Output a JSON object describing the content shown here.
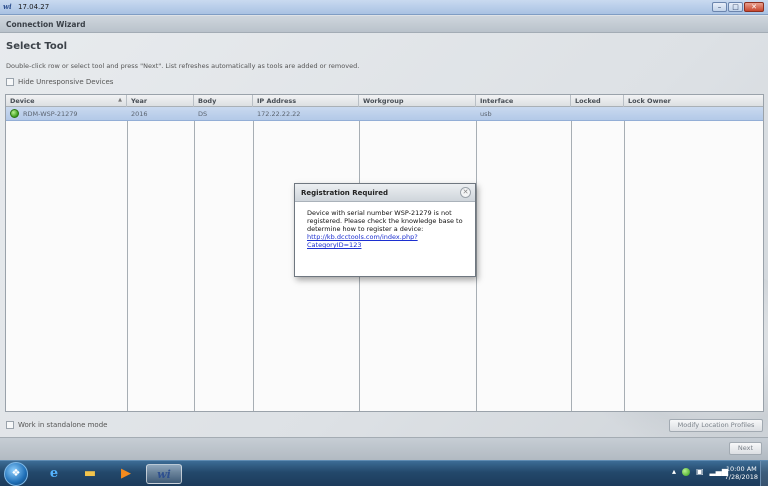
{
  "window": {
    "title": "17.04.27",
    "logo": "wi",
    "controls": [
      "minimize",
      "maximize",
      "close"
    ]
  },
  "wizard": {
    "header": "Connection Wizard",
    "title": "Select Tool",
    "instructions": "Double-click row or select tool and press \"Next\".  List refreshes automatically as tools are added or removed.",
    "hide_unresponsive_label": "Hide Unresponsive Devices",
    "standalone_label": "Work in standalone mode",
    "modify_button": "Modify Location Profiles",
    "next_button": "Next"
  },
  "table": {
    "columns": [
      "Device",
      "Year",
      "Body",
      "IP Address",
      "Workgroup",
      "Interface",
      "Locked",
      "Lock Owner"
    ],
    "rows": [
      {
        "device": "RDM-WSP-21279",
        "year": "2016",
        "body": "DS",
        "ip": "172.22.22.22",
        "workgroup": "",
        "interface": "usb",
        "locked": "",
        "lock_owner": ""
      }
    ]
  },
  "dialog": {
    "title": "Registration Required",
    "message": "Device with serial number WSP-21279 is not registered. Please check the knowledge base to determine how to register a device:",
    "link_line1": "http://kb.dcctools.com/index.php?",
    "link_line2": "CategoryID=123"
  },
  "taskbar": {
    "start_icon": "windows-orb",
    "pinned": [
      "internet-explorer-icon",
      "file-explorer-icon",
      "media-player-icon",
      "wi-app-icon"
    ],
    "clock_time": "10:00 AM",
    "clock_date": "7/28/2018"
  }
}
